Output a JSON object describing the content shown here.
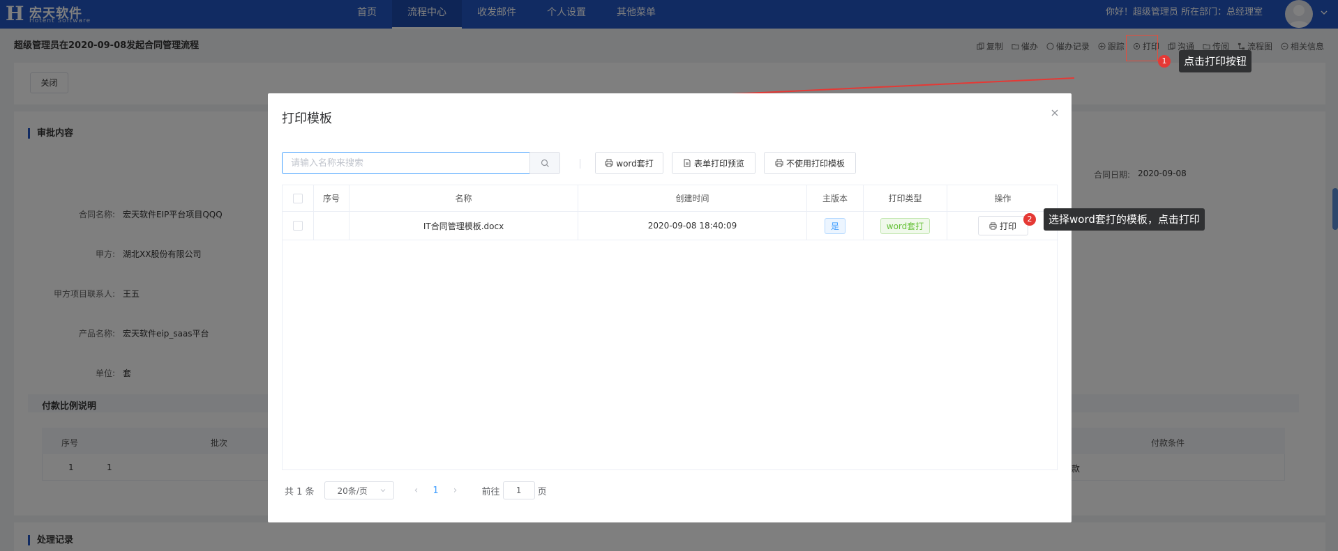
{
  "app": {
    "logo_name": "宏天软件",
    "logo_sub": "Hotent Software",
    "nav": [
      "首页",
      "流程中心",
      "收发邮件",
      "个人设置",
      "其他菜单"
    ],
    "active_nav": "流程中心",
    "greeting": "你好！超级管理员 所在部门：总经理室",
    "brand_color": "#2257c5"
  },
  "page": {
    "title": "超级管理员在2020-09-08发起合同管理流程",
    "close_label": "关闭",
    "toolbar": [
      "复制",
      "催办",
      "催办记录",
      "跟踪",
      "打印",
      "沟通",
      "传阅",
      "流程图",
      "相关信息"
    ],
    "section_approval": "审批内容",
    "contract_date_label": "合同日期:",
    "contract_date_value": "2020-09-08",
    "fields": [
      {
        "label": "合同名称:",
        "value": "宏天软件EIP平台项目QQQ"
      },
      {
        "label": "甲方:",
        "value": "湖北XX股份有限公司"
      },
      {
        "label": "甲方项目联系人:",
        "value": "王五"
      },
      {
        "label": "产品名称:",
        "value": "宏天软件eip_saas平台"
      },
      {
        "label": "单位:",
        "value": "套"
      }
    ],
    "section_payment": "付款比例说明",
    "payment_headers": [
      "序号",
      "批次",
      "付款条件"
    ],
    "payment_row": {
      "seq": "1",
      "batch": "1",
      "cond": "款"
    },
    "section_records": "处理记录"
  },
  "dialog": {
    "title": "打印模板",
    "search_placeholder": "请输入名称来搜索",
    "buttons": [
      "word套打",
      "表单打印预览",
      "不使用打印模板"
    ],
    "columns": [
      "序号",
      "名称",
      "创建时间",
      "主版本",
      "打印类型",
      "操作"
    ],
    "rows": [
      {
        "seq": "",
        "name": "IT合同管理模板.docx",
        "created": "2020-09-08 18:40:09",
        "main": "是",
        "type": "word套打",
        "action": "打印"
      }
    ],
    "pager": {
      "total": "共 1 条",
      "page_size": "20条/页",
      "current": "1",
      "goto_before": "前往",
      "goto_value": "1",
      "goto_after": "页"
    }
  },
  "annotations": [
    {
      "num": "1",
      "text": "点击打印按钮"
    },
    {
      "num": "2",
      "text": "选择word套打的模板，点击打印"
    }
  ]
}
